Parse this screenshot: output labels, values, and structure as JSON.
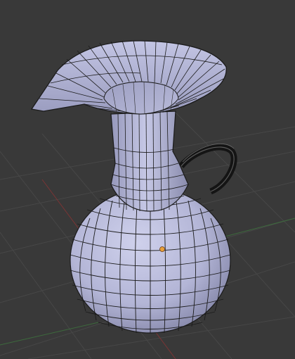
{
  "viewport": {
    "background": "#393939",
    "grid_color": "#444444",
    "x_axis_color": "#8a3a3a",
    "y_axis_color": "#3f6f3f"
  },
  "mesh": {
    "object": "pitcher",
    "surface_color": "#b6b8d8",
    "surface_shadow": "#7c7e9e",
    "wire_color": "#1b1b1b",
    "handle_color": "#141414"
  },
  "origin_marker": {
    "icon": "object-origin-dot",
    "color": "#e8a03a"
  }
}
